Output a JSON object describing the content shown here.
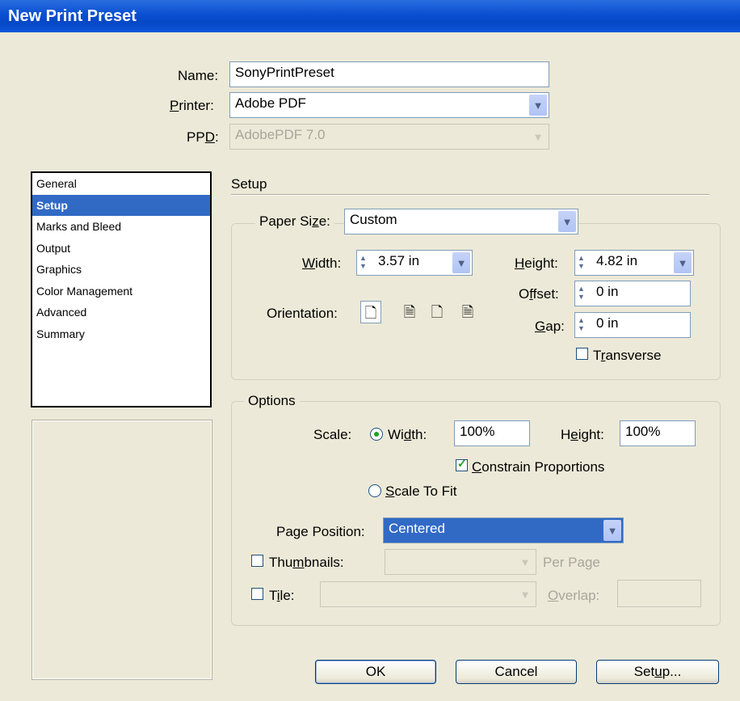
{
  "window": {
    "title": "New Print Preset"
  },
  "fields": {
    "name_label": "Name:",
    "name_value": "SonyPrintPreset",
    "printer_label": "Printer:",
    "printer_value": "Adobe PDF",
    "ppd_label": "PPD:",
    "ppd_value": "AdobePDF 7.0"
  },
  "sidebar": {
    "items": [
      {
        "label": "General"
      },
      {
        "label": "Setup"
      },
      {
        "label": "Marks and Bleed"
      },
      {
        "label": "Output"
      },
      {
        "label": "Graphics"
      },
      {
        "label": "Color Management"
      },
      {
        "label": "Advanced"
      },
      {
        "label": "Summary"
      }
    ],
    "selected": "Setup"
  },
  "setup": {
    "section_title": "Setup",
    "paper_size_label": "Paper Size:",
    "paper_size_value": "Custom",
    "width_label": "Width:",
    "width_value": "3.57 in",
    "height_label": "Height:",
    "height_value": "4.82 in",
    "offset_label": "Offset:",
    "offset_value": "0 in",
    "gap_label": "Gap:",
    "gap_value": "0 in",
    "orientation_label": "Orientation:",
    "transverse_label": "Transverse",
    "transverse_checked": false
  },
  "options": {
    "group_title": "Options",
    "scale_label": "Scale:",
    "width_radio_label": "Width:",
    "width_value": "100%",
    "height_label": "Height:",
    "height_value": "100%",
    "constrain_label": "Constrain Proportions",
    "constrain_checked": true,
    "scale_to_fit_label": "Scale To Fit",
    "page_position_label": "Page Position:",
    "page_position_value": "Centered",
    "thumbnails_label": "Thumbnails:",
    "thumbnails_value": "",
    "per_page_label": "Per Page",
    "tile_label": "Tile:",
    "tile_value": "",
    "overlap_label": "Overlap:",
    "overlap_value": ""
  },
  "buttons": {
    "ok": "OK",
    "cancel": "Cancel",
    "setup": "Setup..."
  },
  "icons": {
    "orientation": [
      "portrait-icon",
      "landscape-icon",
      "reverse-portrait-icon",
      "reverse-landscape-icon"
    ]
  }
}
